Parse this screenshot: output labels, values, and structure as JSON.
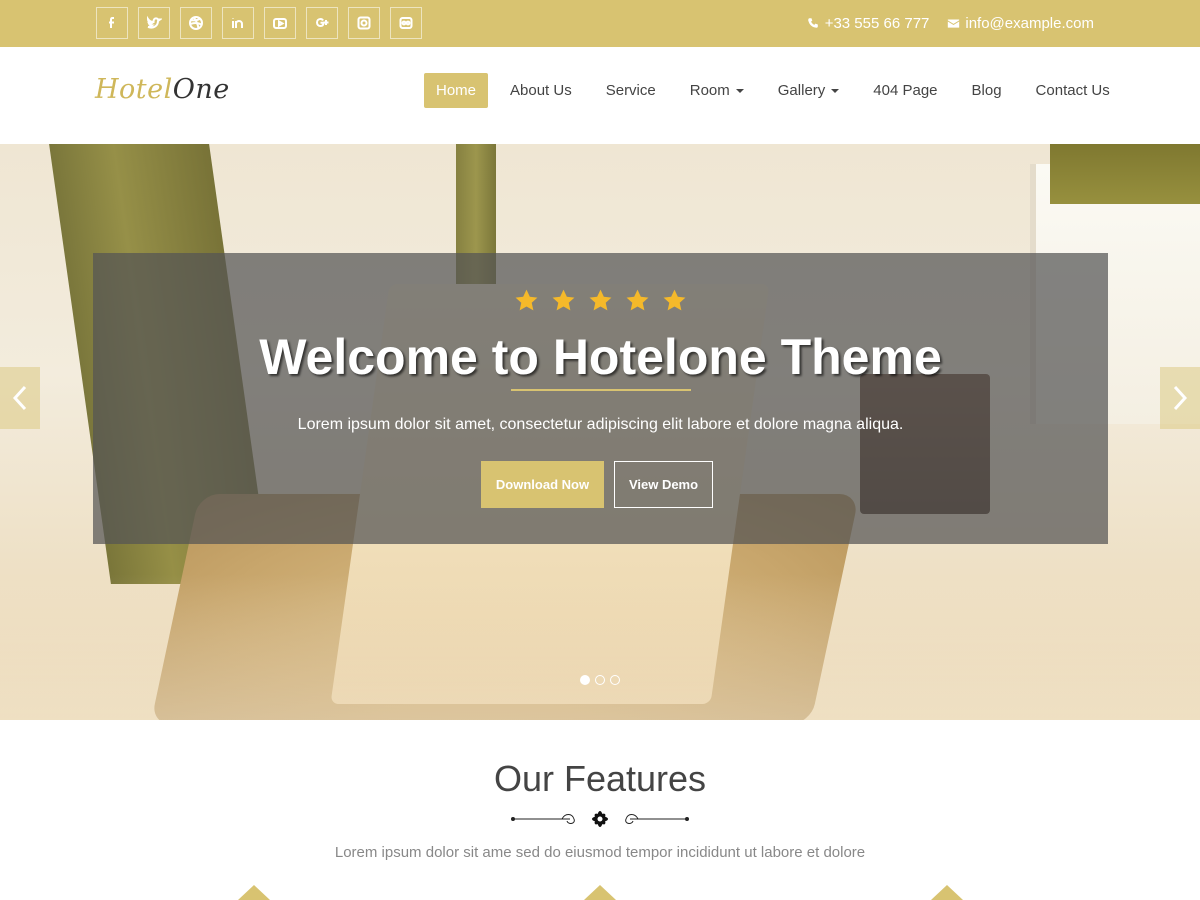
{
  "topbar": {
    "social": [
      {
        "name": "facebook-icon",
        "glyph": "f"
      },
      {
        "name": "twitter-icon",
        "glyph": "t"
      },
      {
        "name": "dribbble-icon",
        "glyph": "d"
      },
      {
        "name": "linkedin-icon",
        "glyph": "in"
      },
      {
        "name": "youtube-icon",
        "glyph": "You"
      },
      {
        "name": "google-plus-icon",
        "glyph": "g+"
      },
      {
        "name": "instagram-icon",
        "glyph": "ig"
      },
      {
        "name": "flickr-icon",
        "glyph": "fl"
      }
    ],
    "phone": "+33 555 66 777",
    "email": "info@example.com"
  },
  "logo": {
    "part1": "Hotel",
    "part2": "One"
  },
  "nav": {
    "items": [
      {
        "label": "Home"
      },
      {
        "label": "About Us"
      },
      {
        "label": "Service"
      },
      {
        "label": "Room"
      },
      {
        "label": "Gallery"
      },
      {
        "label": "404 Page"
      },
      {
        "label": "Blog"
      },
      {
        "label": "Contact Us"
      }
    ]
  },
  "hero": {
    "rating": 5,
    "title": "Welcome to Hotelone Theme",
    "subtitle": "Lorem ipsum dolor sit amet, consectetur adipiscing elit labore et dolore magna aliqua.",
    "primary_button": "Download Now",
    "secondary_button": "View Demo",
    "slides": 3,
    "active_slide": 1
  },
  "features": {
    "title": "Our Features",
    "subtitle": "Lorem ipsum dolor sit ame sed do eiusmod tempor incididunt ut labore et dolore"
  },
  "colors": {
    "accent": "#d8c371",
    "star": "#f5b92a"
  }
}
